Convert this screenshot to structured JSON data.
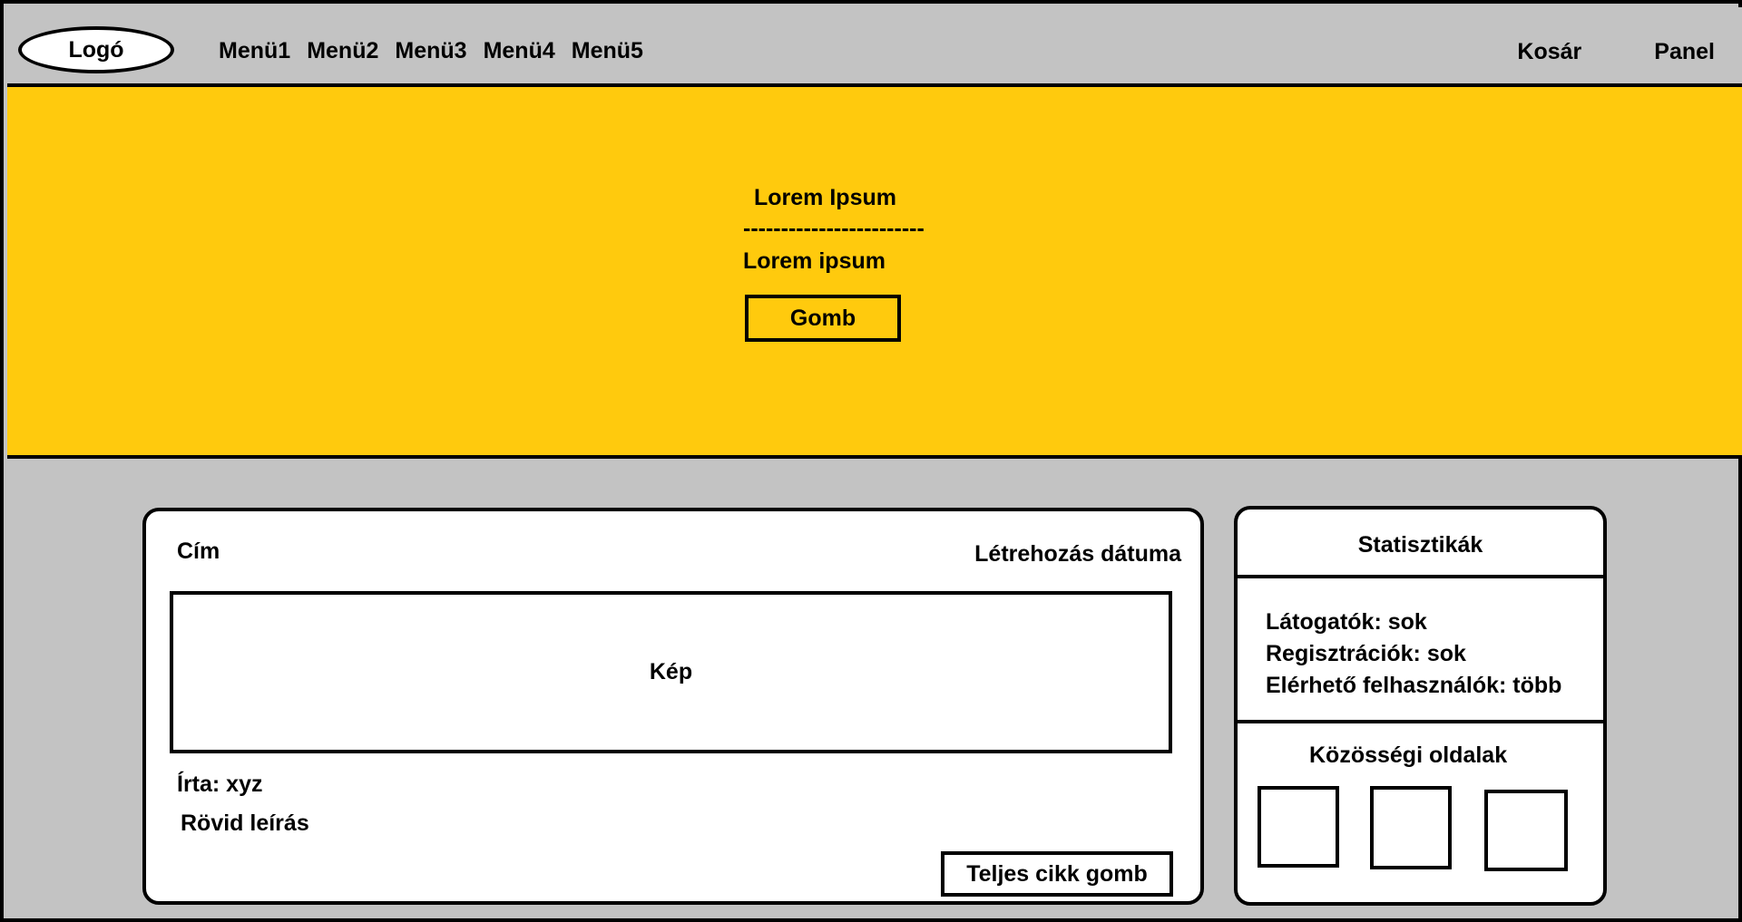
{
  "header": {
    "logo": "Logó",
    "menu": [
      {
        "label": "Menü1"
      },
      {
        "label": "Menü2"
      },
      {
        "label": "Menü3"
      },
      {
        "label": "Menü4"
      },
      {
        "label": "Menü5"
      }
    ],
    "cart": "Kosár",
    "panel": "Panel"
  },
  "hero": {
    "title": "Lorem Ipsum",
    "divider": "------------------------",
    "subtitle": "Lorem ipsum",
    "button": "Gomb"
  },
  "article": {
    "title": "Cím",
    "date": "Létrehozás dátuma",
    "image": "Kép",
    "author": "Írta: xyz",
    "summary": "Rövid leírás",
    "button": "Teljes cikk gomb"
  },
  "stats": {
    "heading": "Statisztikák",
    "lines": [
      {
        "text": "Látogatók: sok"
      },
      {
        "text": "Regisztrációk: sok"
      },
      {
        "text": "Elérhető felhasználók: több"
      }
    ],
    "social_heading": "Közösségi oldalak"
  },
  "colors": {
    "hero_background": "#ffca0d",
    "page_background": "#c3c3c3",
    "card_background": "#ffffff",
    "border": "#000000"
  }
}
